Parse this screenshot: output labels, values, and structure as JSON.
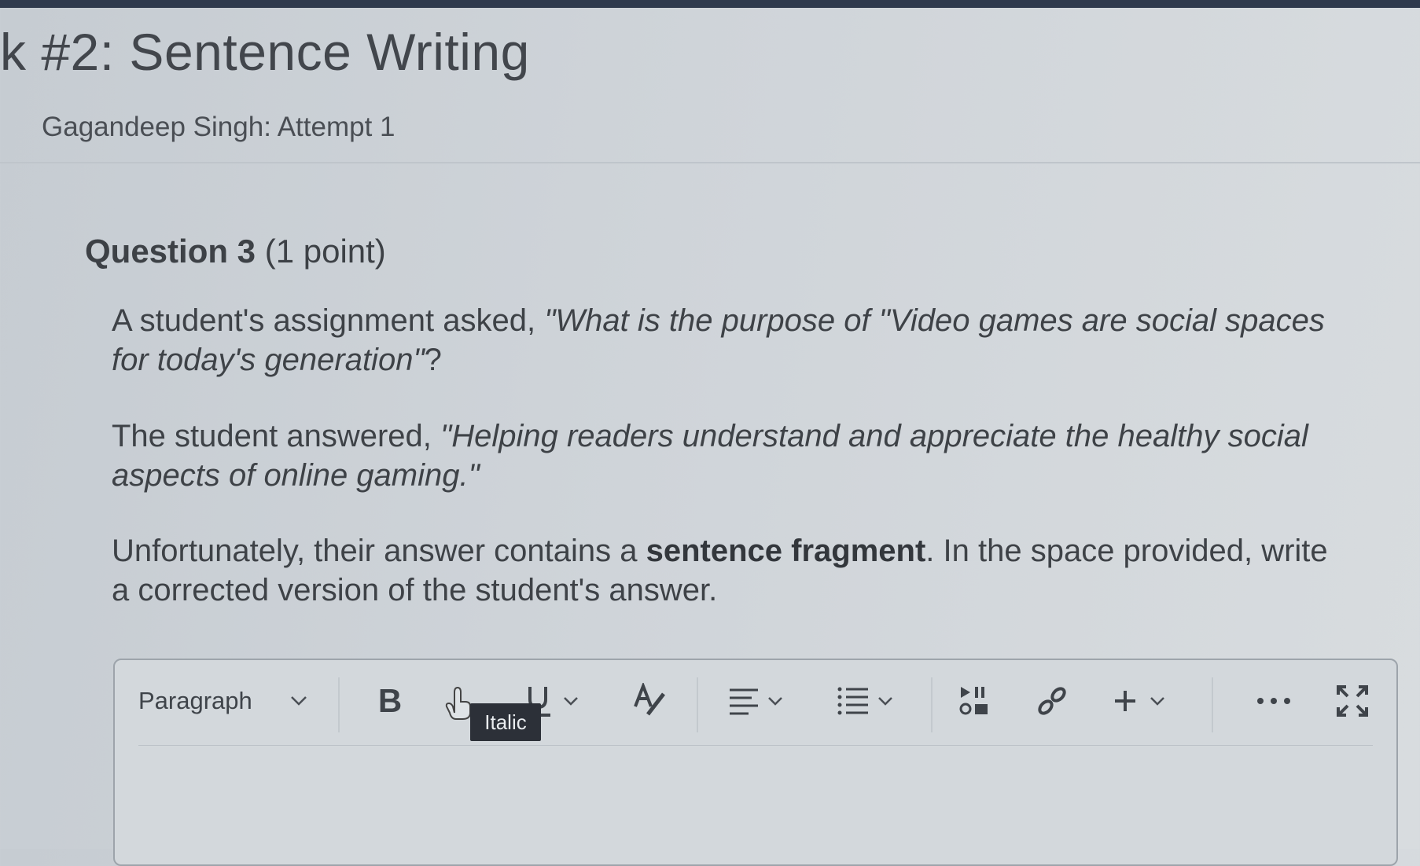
{
  "page": {
    "title": "k #2: Sentence Writing",
    "attempt": "Gagandeep Singh: Attempt 1"
  },
  "question": {
    "number_label": "Question 3",
    "points": "(1 point)",
    "p1_prefix": "A student's assignment asked, ",
    "p1_italic": "\"What is the purpose of \"Video games are social spaces for today's generation\"",
    "p1_suffix": "?",
    "p2_prefix": "The student answered, ",
    "p2_italic": "\"Helping readers understand and appreciate the healthy social aspects of online gaming.\"",
    "p3_prefix": "Unfortunately, their answer contains a ",
    "p3_bold": "sentence fragment",
    "p3_suffix": ". In the space provided, write a corrected version of the student's answer."
  },
  "editor": {
    "format_select": "Paragraph",
    "tooltip": "Italic",
    "icons": [
      "chevron-down-icon",
      "bold-icon",
      "italic-icon",
      "underline-icon",
      "text-color-icon",
      "align-icon",
      "list-icon",
      "media-icon",
      "link-icon",
      "plus-icon",
      "more-icon",
      "fullscreen-icon"
    ],
    "bold_glyph": "B"
  }
}
